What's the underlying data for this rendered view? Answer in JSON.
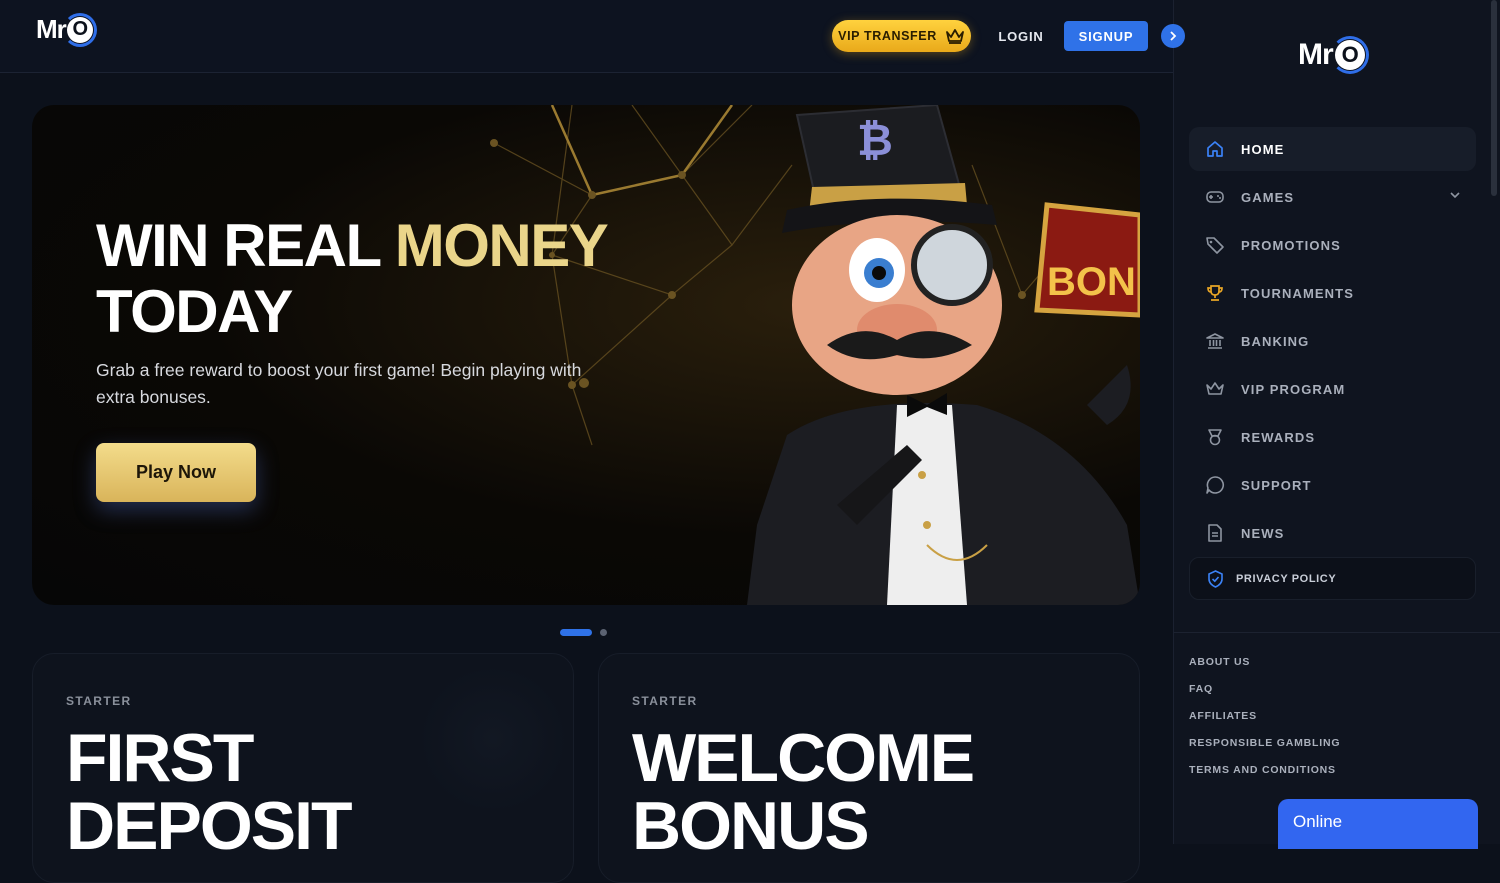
{
  "brand": {
    "logo_mr": "Mr",
    "logo_o": "O"
  },
  "header": {
    "vip_transfer": "VIP TRANSFER",
    "login": "LOGIN",
    "signup": "SIGNUP",
    "collapse_icon": "chevron-right-icon"
  },
  "hero": {
    "title_white": "WIN REAL ",
    "title_gold": "MONEY",
    "title_line2": "TODAY",
    "subtitle": "Grab a free reward to boost your first game! Begin playing with extra bonuses.",
    "cta": "Play Now",
    "art_badge_text": "BON",
    "slides_total": 2,
    "slide_active": 1
  },
  "cards": [
    {
      "label": "STARTER",
      "title_line1": "FIRST",
      "title_line2": "DEPOSIT"
    },
    {
      "label": "STARTER",
      "title_line1": "WELCOME",
      "title_line2": "BONUS"
    }
  ],
  "sidebar": {
    "items": [
      {
        "label": "HOME",
        "icon": "home-icon",
        "active": true
      },
      {
        "label": "GAMES",
        "icon": "gamepad-icon",
        "expandable": true
      },
      {
        "label": "PROMOTIONS",
        "icon": "tag-icon"
      },
      {
        "label": "TOURNAMENTS",
        "icon": "trophy-icon"
      },
      {
        "label": "BANKING",
        "icon": "bank-icon"
      },
      {
        "label": "VIP PROGRAM",
        "icon": "crown-icon"
      },
      {
        "label": "REWARDS",
        "icon": "medal-icon"
      },
      {
        "label": "SUPPORT",
        "icon": "chat-icon"
      },
      {
        "label": "NEWS",
        "icon": "document-icon"
      }
    ],
    "privacy": "PRIVACY POLICY",
    "links": [
      "ABOUT US",
      "FAQ",
      "AFFILIATES",
      "RESPONSIBLE GAMBLING",
      "TERMS AND CONDITIONS"
    ]
  },
  "chat": {
    "status": "Online"
  },
  "colors": {
    "accent_blue": "#2f72e8",
    "gold": "#ead58a",
    "vip_yellow": "#ffd23e",
    "background": "#0c111b"
  }
}
